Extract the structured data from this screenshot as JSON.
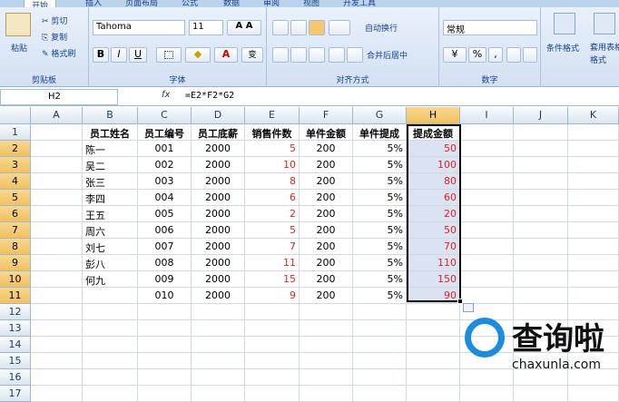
{
  "tabs": [
    "开始",
    "插入",
    "页面布局",
    "公式",
    "数据",
    "审阅",
    "视图",
    "开发工具"
  ],
  "clipboard": {
    "paste": "粘贴",
    "cut": "剪切",
    "copy": "复制",
    "format_painter": "格式刷",
    "label": "剪贴板"
  },
  "font": {
    "name": "Tahoma",
    "size": "11",
    "bold": "B",
    "italic": "I",
    "underline": "U",
    "color": "A",
    "label": "字体"
  },
  "alignment": {
    "wrap": "自动换行",
    "merge": "合并后居中",
    "label": "对齐方式"
  },
  "number": {
    "format": "常规",
    "percent": "%",
    "comma": ",",
    "label": "数字"
  },
  "styles": {
    "cond_format": "条件格式",
    "table_format": "套用表格格式"
  },
  "formula_bar": {
    "cell_ref": "H2",
    "fx": "fx",
    "formula": "=E2*F2*G2"
  },
  "columns": [
    "A",
    "B",
    "C",
    "D",
    "E",
    "F",
    "G",
    "H",
    "I",
    "J",
    "K"
  ],
  "rows": [
    "1",
    "2",
    "3",
    "4",
    "5",
    "6",
    "7",
    "8",
    "9",
    "10",
    "11",
    "12",
    "13",
    "14",
    "15",
    "16",
    "17"
  ],
  "headers": [
    "员工姓名",
    "员工编号",
    "员工底薪",
    "销售件数",
    "单件金额",
    "单件提成",
    "提成金额"
  ],
  "table": [
    [
      "陈一",
      "001",
      "2000",
      "5",
      "200",
      "5%",
      "50"
    ],
    [
      "吴二",
      "002",
      "2000",
      "10",
      "200",
      "5%",
      "100"
    ],
    [
      "张三",
      "003",
      "2000",
      "8",
      "200",
      "5%",
      "80"
    ],
    [
      "李四",
      "004",
      "2000",
      "6",
      "200",
      "5%",
      "60"
    ],
    [
      "王五",
      "005",
      "2000",
      "2",
      "200",
      "5%",
      "20"
    ],
    [
      "周六",
      "006",
      "2000",
      "5",
      "200",
      "5%",
      "50"
    ],
    [
      "刘七",
      "007",
      "2000",
      "7",
      "200",
      "5%",
      "70"
    ],
    [
      "彭八",
      "008",
      "2000",
      "11",
      "200",
      "5%",
      "110"
    ],
    [
      "何九",
      "009",
      "2000",
      "15",
      "200",
      "5%",
      "150"
    ],
    [
      "",
      "010",
      "2000",
      "9",
      "200",
      "5%",
      "90"
    ]
  ],
  "watermark": {
    "cn": "查询啦",
    "en": "chaxunla.com"
  },
  "colors": {
    "accent": "#e0241b",
    "brand_blue": "#1a8de0",
    "header_sel": "#f1c15f"
  }
}
